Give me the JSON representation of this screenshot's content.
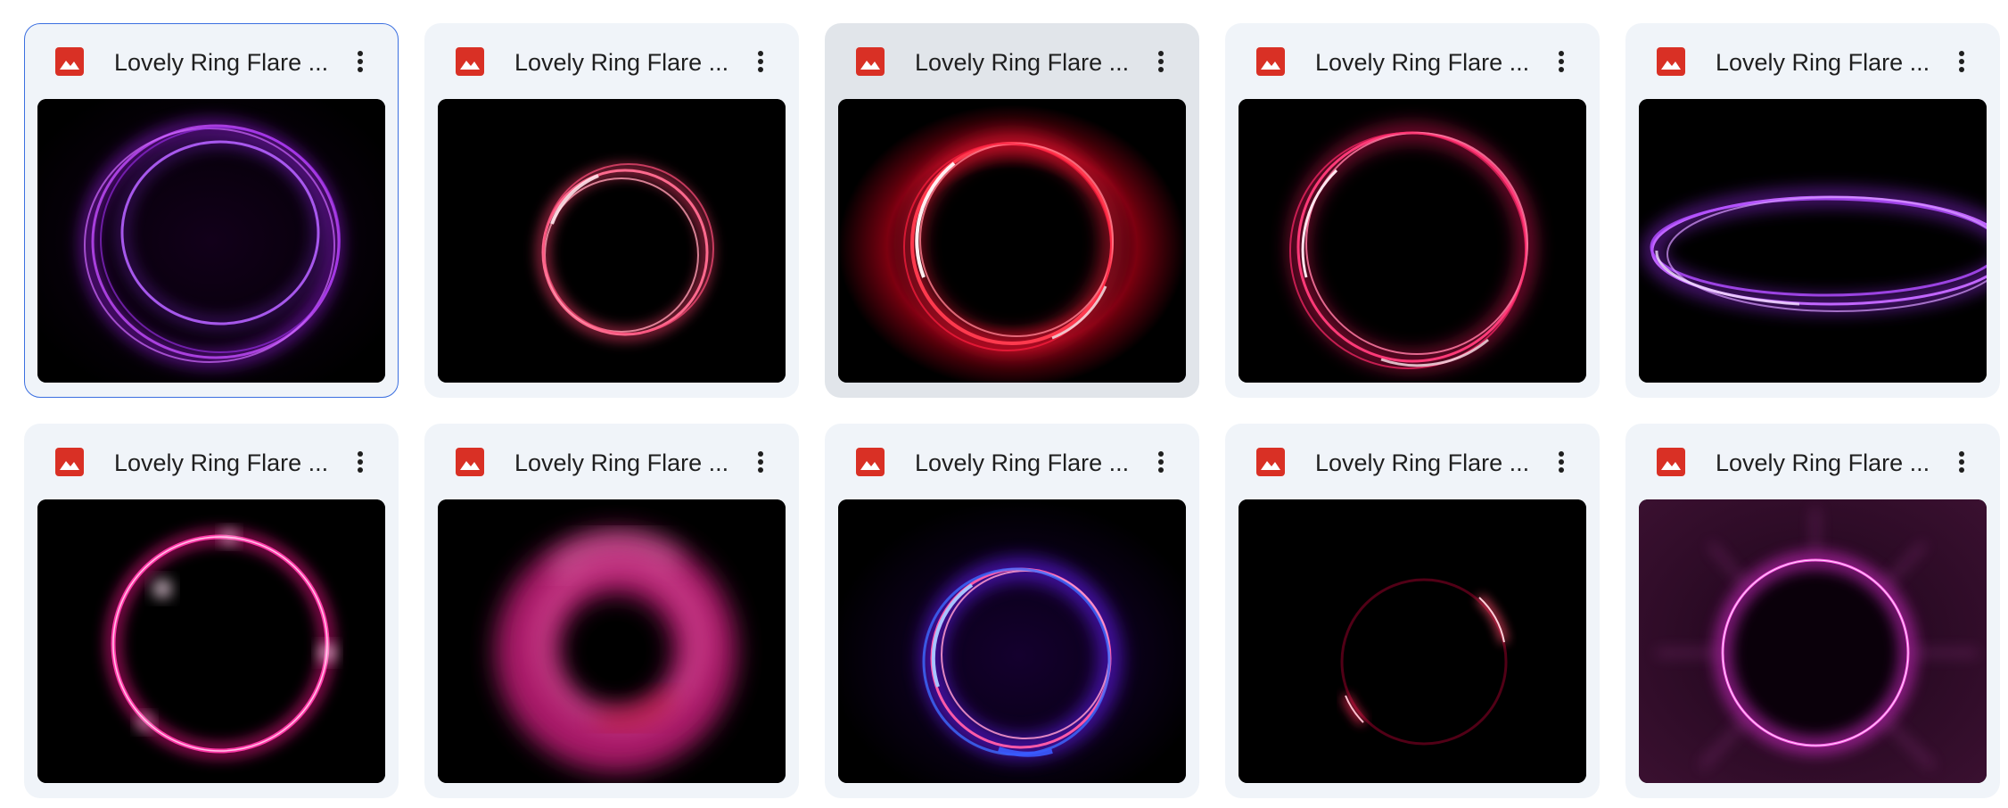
{
  "files": [
    {
      "title": "Lovely Ring Flare ...",
      "icon": "image-file-icon",
      "menu_icon": "more-vert-icon",
      "thumbnail": "violet double ring flare"
    },
    {
      "title": "Lovely Ring Flare ...",
      "icon": "image-file-icon",
      "menu_icon": "more-vert-icon",
      "thumbnail": "small pink ring flare"
    },
    {
      "title": "Lovely Ring Flare ...",
      "icon": "image-file-icon",
      "menu_icon": "more-vert-icon",
      "thumbnail": "red glowing ring flare"
    },
    {
      "title": "Lovely Ring Flare ...",
      "icon": "image-file-icon",
      "menu_icon": "more-vert-icon",
      "thumbnail": "pink glowing ring flare"
    },
    {
      "title": "Lovely Ring Flare ...",
      "icon": "image-file-icon",
      "menu_icon": "more-vert-icon",
      "thumbnail": "violet elliptical ring flare"
    },
    {
      "title": "Lovely Ring Flare ...",
      "icon": "image-file-icon",
      "menu_icon": "more-vert-icon",
      "thumbnail": "hot pink sparkling ring"
    },
    {
      "title": "Lovely Ring Flare ...",
      "icon": "image-file-icon",
      "menu_icon": "more-vert-icon",
      "thumbnail": "thick pink blurred ring"
    },
    {
      "title": "Lovely Ring Flare ...",
      "icon": "image-file-icon",
      "menu_icon": "more-vert-icon",
      "thumbnail": "blue and pink ring flare"
    },
    {
      "title": "Lovely Ring Flare ...",
      "icon": "image-file-icon",
      "menu_icon": "more-vert-icon",
      "thumbnail": "dark eclipse ring"
    },
    {
      "title": "Lovely Ring Flare ...",
      "icon": "image-file-icon",
      "menu_icon": "more-vert-icon",
      "thumbnail": "magenta rayed ring"
    }
  ],
  "colors": {
    "card_bg": "#f0f4f9",
    "card_hover_bg": "#e1e5ea",
    "selected_border": "#3b6fe0",
    "image_icon_red": "#d93025",
    "text": "#1f1f1f"
  },
  "selected_index": 0,
  "hovered_index": 2
}
